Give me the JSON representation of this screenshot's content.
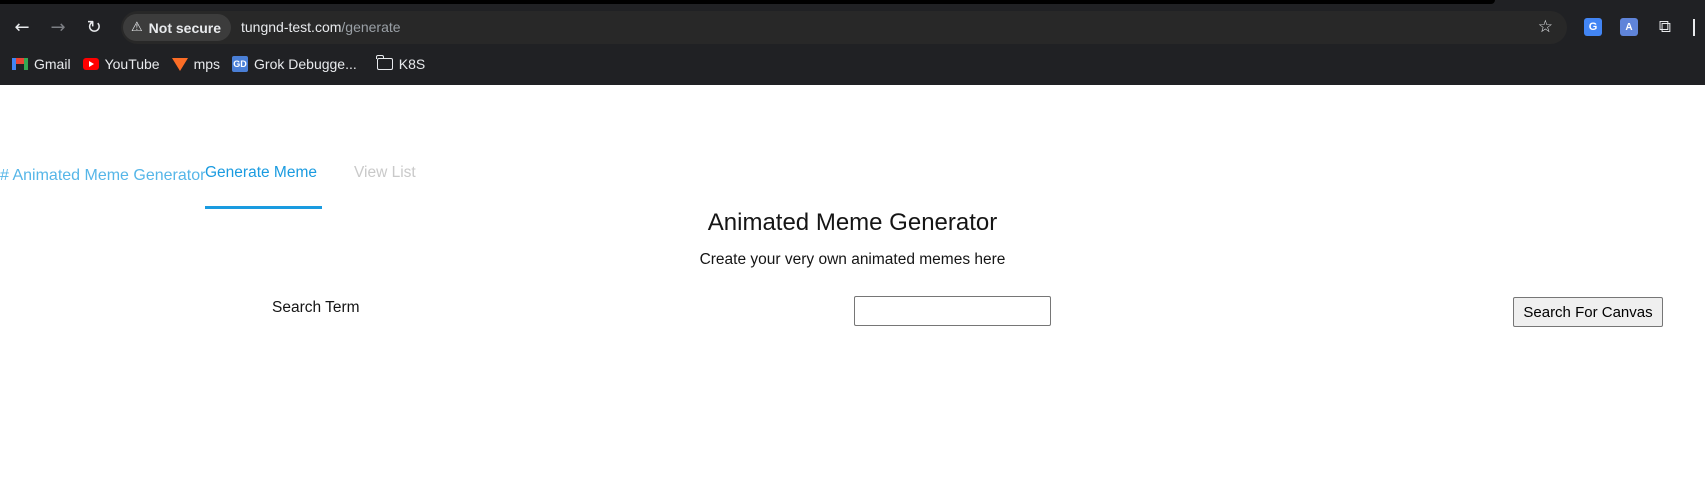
{
  "browser": {
    "security_label": "Not secure",
    "url_host": "tungnd-test.com",
    "url_path": "/generate",
    "back_icon": "←",
    "forward_icon": "→",
    "reload_icon": "↻",
    "star_icon": "☆",
    "translate_ext": "G",
    "lang_ext": "A",
    "puzzle_icon": "⧉"
  },
  "bookmarks": [
    {
      "label": "Gmail",
      "icon": "gmail-icon"
    },
    {
      "label": "YouTube",
      "icon": "youtube-icon"
    },
    {
      "label": "mps",
      "icon": "gitlab-icon"
    },
    {
      "label": "Grok Debugge...",
      "icon": "gd-icon",
      "icon_text": "GD"
    },
    {
      "label": "K8S",
      "icon": "folder-icon"
    }
  ],
  "nav": {
    "brand": "# Animated Meme Generator",
    "tabs": [
      {
        "label": "Generate Meme",
        "active": true
      },
      {
        "label": "View List",
        "active": false
      }
    ]
  },
  "main": {
    "title": "Animated Meme Generator",
    "subtitle": "Create your very own animated memes here",
    "search_label": "Search Term",
    "search_value": "",
    "search_button": "Search For Canvas"
  },
  "colors": {
    "accent": "#1a9be0",
    "brand_link": "#56b6e8",
    "inactive_tab": "#c9c9c9",
    "chrome_bg": "#202124"
  }
}
